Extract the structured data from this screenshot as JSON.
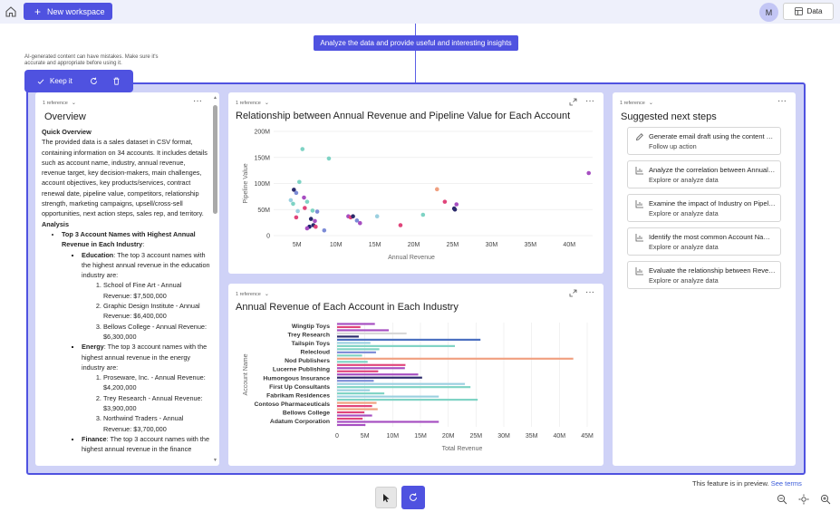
{
  "topbar": {
    "new_workspace": "New workspace",
    "avatar": "M",
    "data_button": "Data"
  },
  "prompt": "Analyze the data and provide useful and interesting insights",
  "disclaimer": "AI-generated content can have mistakes. Make sure it's accurate and appropriate before using it.",
  "keep_bar": {
    "keep_label": "Keep it"
  },
  "overview": {
    "ref_label": "1 reference",
    "title": "Overview",
    "quick_heading": "Quick Overview",
    "quick_text": "The provided data is a sales dataset in CSV format, containing information on 34 accounts. It includes details such as account name, industry, annual revenue, revenue target, key decision-makers, main challenges, account objectives, key products/services, contract renewal date, pipeline value, competitors, relationship strength, marketing campaigns, upsell/cross-sell opportunities, next action steps, sales rep, and territory.",
    "analysis_heading": "Analysis",
    "top3_title": "Top 3 Account Names with Highest Annual Revenue in Each Industry",
    "top3_colon": ":",
    "industries": [
      {
        "name": "Education",
        "intro": ": The top 3 account names with the highest annual revenue in the education industry are:",
        "items": [
          "School of Fine Art - Annual Revenue: $7,500,000",
          "Graphic Design Institute - Annual Revenue: $6,400,000",
          "Bellows College - Annual Revenue: $6,300,000"
        ]
      },
      {
        "name": "Energy",
        "intro": ": The top 3 account names with the highest annual revenue in the energy industry are:",
        "items": [
          "Proseware, Inc. - Annual Revenue: $4,200,000",
          "Trey Research - Annual Revenue: $3,900,000",
          "Northwind Traders - Annual Revenue: $3,700,000"
        ]
      },
      {
        "name": "Finance",
        "intro": ": The top 3 account names with the highest annual revenue in the finance",
        "items": []
      }
    ]
  },
  "scatter_panel": {
    "ref_label": "1 reference",
    "title": "Relationship between Annual Revenue and Pipeline Value for Each Account"
  },
  "bar_panel": {
    "ref_label": "1 reference",
    "title": "Annual Revenue of Each Account in Each Industry"
  },
  "suggestions": {
    "ref_label": "1 reference",
    "title": "Suggested next steps",
    "items": [
      {
        "title": "Generate email draft using the content above",
        "subtitle": "Follow up action",
        "icon": "pencil-icon"
      },
      {
        "title": "Analyze the correlation between Annual Revenue and Pipeline Value",
        "subtitle": "Explore or analyze data",
        "icon": "chart-icon"
      },
      {
        "title": "Examine the impact of Industry on Pipeline Value",
        "subtitle": "Explore or analyze data",
        "icon": "chart-icon"
      },
      {
        "title": "Identify the most common Account Names",
        "subtitle": "Explore or analyze data",
        "icon": "chart-icon"
      },
      {
        "title": "Evaluate the relationship between Revenue and Industry",
        "subtitle": "Explore or analyze data",
        "icon": "chart-icon"
      }
    ]
  },
  "footer": {
    "preview_text": "This feature is in preview.",
    "see_terms": "See terms"
  },
  "colors": {
    "accent": "#4f52e0",
    "frame_bg": "#cfd2f7"
  },
  "chart_data": [
    {
      "type": "scatter",
      "title": "Relationship between Annual Revenue and Pipeline Value for Each Account",
      "xlabel": "Annual Revenue",
      "ylabel": "Pipeline Value",
      "xlim": [
        2000000,
        43000000
      ],
      "ylim": [
        0,
        200000000
      ],
      "xticks": [
        "5M",
        "10M",
        "15M",
        "20M",
        "25M",
        "30M",
        "35M",
        "40M"
      ],
      "xtick_values": [
        5000000,
        10000000,
        15000000,
        20000000,
        25000000,
        30000000,
        35000000,
        40000000
      ],
      "yticks": [
        "0",
        "50M",
        "100M",
        "150M",
        "200M"
      ],
      "ytick_values": [
        0,
        50000000,
        100000000,
        150000000,
        200000000
      ],
      "grid": "horizontal",
      "points": [
        {
          "x": 5700000,
          "y": 166000000,
          "color": "#7ed3c4"
        },
        {
          "x": 9100000,
          "y": 148000000,
          "color": "#7ed3c4"
        },
        {
          "x": 5300000,
          "y": 103000000,
          "color": "#7ed3c4"
        },
        {
          "x": 4600000,
          "y": 88000000,
          "color": "#2b2a6b"
        },
        {
          "x": 4900000,
          "y": 82000000,
          "color": "#7c8bd6"
        },
        {
          "x": 4200000,
          "y": 68000000,
          "color": "#9bd0e0"
        },
        {
          "x": 4500000,
          "y": 61000000,
          "color": "#7ed3c4"
        },
        {
          "x": 5900000,
          "y": 73000000,
          "color": "#a64ec1"
        },
        {
          "x": 6300000,
          "y": 65000000,
          "color": "#7ed3c4"
        },
        {
          "x": 6000000,
          "y": 53000000,
          "color": "#e0447a"
        },
        {
          "x": 5100000,
          "y": 47000000,
          "color": "#9bd0e0"
        },
        {
          "x": 7000000,
          "y": 48000000,
          "color": "#7ed3c4"
        },
        {
          "x": 7600000,
          "y": 46000000,
          "color": "#7c8bd6"
        },
        {
          "x": 4900000,
          "y": 35000000,
          "color": "#e0447a"
        },
        {
          "x": 6800000,
          "y": 32000000,
          "color": "#2b2a6b"
        },
        {
          "x": 7300000,
          "y": 28000000,
          "color": "#a64ec1"
        },
        {
          "x": 7100000,
          "y": 20000000,
          "color": "#2b2a6b"
        },
        {
          "x": 6600000,
          "y": 17000000,
          "color": "#1f1f6e"
        },
        {
          "x": 7400000,
          "y": 17000000,
          "color": "#e0447a"
        },
        {
          "x": 6300000,
          "y": 14000000,
          "color": "#a64ec1"
        },
        {
          "x": 8500000,
          "y": 10000000,
          "color": "#7c8bd6"
        },
        {
          "x": 11600000,
          "y": 37000000,
          "color": "#a64ec1"
        },
        {
          "x": 11900000,
          "y": 35000000,
          "color": "#e0447a"
        },
        {
          "x": 12200000,
          "y": 37000000,
          "color": "#2b2a6b"
        },
        {
          "x": 12700000,
          "y": 29000000,
          "color": "#7c8bd6"
        },
        {
          "x": 13100000,
          "y": 24000000,
          "color": "#a64ec1"
        },
        {
          "x": 15300000,
          "y": 37000000,
          "color": "#9bd0e0"
        },
        {
          "x": 18300000,
          "y": 20000000,
          "color": "#e0447a"
        },
        {
          "x": 21200000,
          "y": 40000000,
          "color": "#7ed3c4"
        },
        {
          "x": 23000000,
          "y": 89000000,
          "color": "#f0a080"
        },
        {
          "x": 24000000,
          "y": 65000000,
          "color": "#e0447a"
        },
        {
          "x": 25200000,
          "y": 52000000,
          "color": "#2b2a6b"
        },
        {
          "x": 25500000,
          "y": 60000000,
          "color": "#a64ec1"
        },
        {
          "x": 25300000,
          "y": 50000000,
          "color": "#2b2a6b"
        },
        {
          "x": 42500000,
          "y": 120000000,
          "color": "#a64ec1"
        }
      ]
    },
    {
      "type": "bar",
      "orientation": "horizontal",
      "title": "Annual Revenue of Each Account in Each Industry",
      "xlabel": "Total Revenue",
      "ylabel": "Account Name",
      "xlim": [
        0,
        45000000
      ],
      "xticks": [
        "0",
        "5M",
        "10M",
        "15M",
        "20M",
        "25M",
        "30M",
        "35M",
        "40M",
        "45M"
      ],
      "xtick_values": [
        0,
        5000000,
        10000000,
        15000000,
        20000000,
        25000000,
        30000000,
        35000000,
        40000000,
        45000000
      ],
      "grid": "vertical",
      "labeled_categories": [
        "Wingtip Toys",
        "Trey Research",
        "Tailspin Toys",
        "Relecloud",
        "Nod Publishers",
        "Lucerne Publishing",
        "Humongous Insurance",
        "First Up Consultants",
        "Fabrikam Residences",
        "Contoso Pharmaceuticals",
        "Bellows College",
        "Adatum Corporation"
      ],
      "bars": [
        {
          "value": 6800000,
          "color": "#a64ec1"
        },
        {
          "value": 4200000,
          "color": "#e0447a"
        },
        {
          "value": 9300000,
          "color": "#a64ec1"
        },
        {
          "value": 12500000,
          "color": "#d8d8d8"
        },
        {
          "value": 3900000,
          "color": "#2b2a6b"
        },
        {
          "value": 25800000,
          "color": "#4a6fc0"
        },
        {
          "value": 6000000,
          "color": "#9bd0e0"
        },
        {
          "value": 21200000,
          "color": "#7ed3c4"
        },
        {
          "value": 7600000,
          "color": "#7ed3c4"
        },
        {
          "value": 7000000,
          "color": "#7c8bd6"
        },
        {
          "value": 4500000,
          "color": "#7ed3c4"
        },
        {
          "value": 42500000,
          "color": "#f0a080"
        },
        {
          "value": 5500000,
          "color": "#7ed3c4"
        },
        {
          "value": 12300000,
          "color": "#e0447a"
        },
        {
          "value": 12200000,
          "color": "#a64ec1"
        },
        {
          "value": 7400000,
          "color": "#e0447a"
        },
        {
          "value": 14600000,
          "color": "#a64ec1"
        },
        {
          "value": 15300000,
          "color": "#2b2a6b"
        },
        {
          "value": 6600000,
          "color": "#7c8bd6"
        },
        {
          "value": 23000000,
          "color": "#9bd0e0"
        },
        {
          "value": 24000000,
          "color": "#7ed3c4"
        },
        {
          "value": 5900000,
          "color": "#9bd0e0"
        },
        {
          "value": 8500000,
          "color": "#7ed3c4"
        },
        {
          "value": 18300000,
          "color": "#9bd0e0"
        },
        {
          "value": 25300000,
          "color": "#7ed3c4"
        },
        {
          "value": 7100000,
          "color": "#f0a080"
        },
        {
          "value": 6300000,
          "color": "#e0447a"
        },
        {
          "value": 7300000,
          "color": "#f0a080"
        },
        {
          "value": 4900000,
          "color": "#e0447a"
        },
        {
          "value": 6300000,
          "color": "#a64ec1"
        },
        {
          "value": 4600000,
          "color": "#e0447a"
        },
        {
          "value": 18300000,
          "color": "#a64ec1"
        },
        {
          "value": 5100000,
          "color": "#a64ec1"
        }
      ]
    }
  ]
}
